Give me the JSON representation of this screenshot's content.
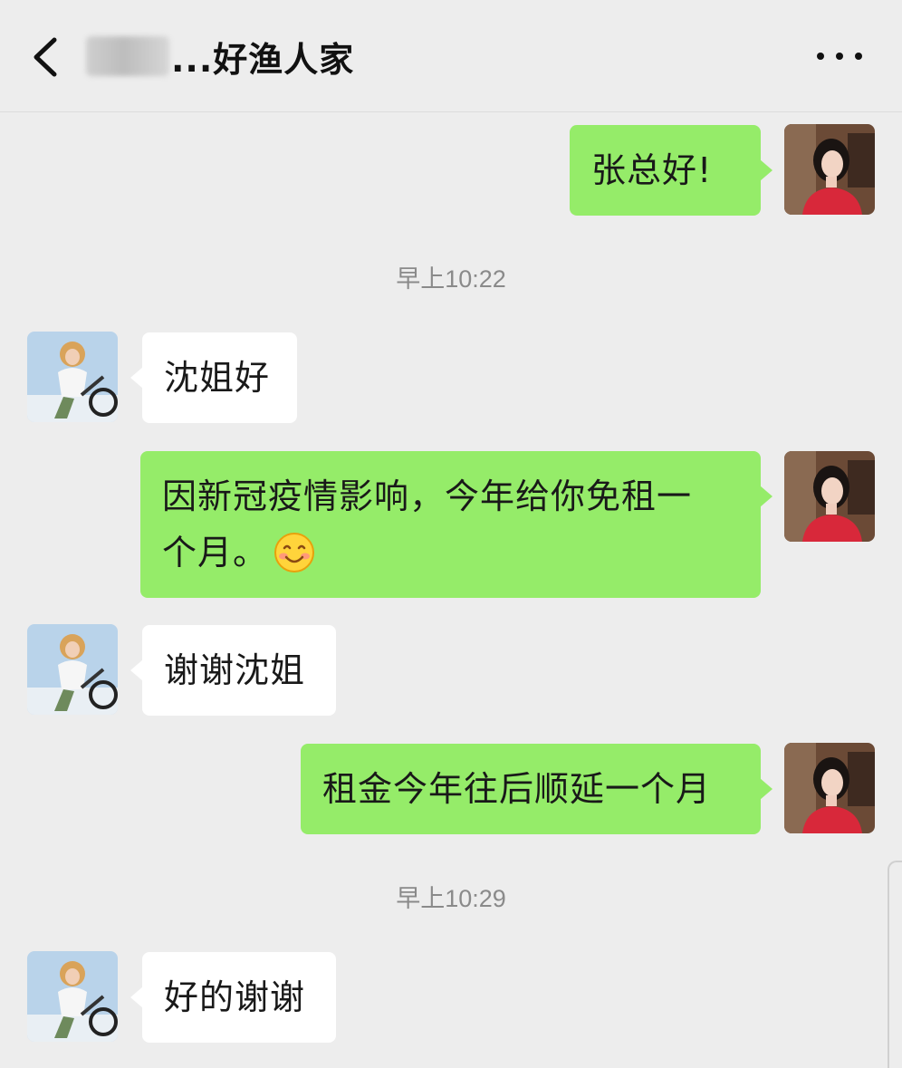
{
  "header": {
    "title": "...好渔人家",
    "back_icon": "chevron-left-icon",
    "more_icon": "more-dots-icon"
  },
  "messages": [
    {
      "side": "right",
      "text": "张总好!"
    },
    {
      "side": "center",
      "text": "早上10:22"
    },
    {
      "side": "left",
      "text": "沈姐好"
    },
    {
      "side": "right",
      "text": "因新冠疫情影响，今年给你免租一",
      "text2": "个月。",
      "emoji": "smiling-face-icon"
    },
    {
      "side": "left",
      "text": "谢谢沈姐"
    },
    {
      "side": "right",
      "text": "租金今年往后顺延一个月"
    },
    {
      "side": "center",
      "text": "早上10:29"
    },
    {
      "side": "left",
      "text": "好的谢谢"
    }
  ],
  "colors": {
    "background": "#ededed",
    "outgoing_bubble": "#95ec69",
    "incoming_bubble": "#ffffff",
    "timestamp_text": "#8a8a8a"
  }
}
